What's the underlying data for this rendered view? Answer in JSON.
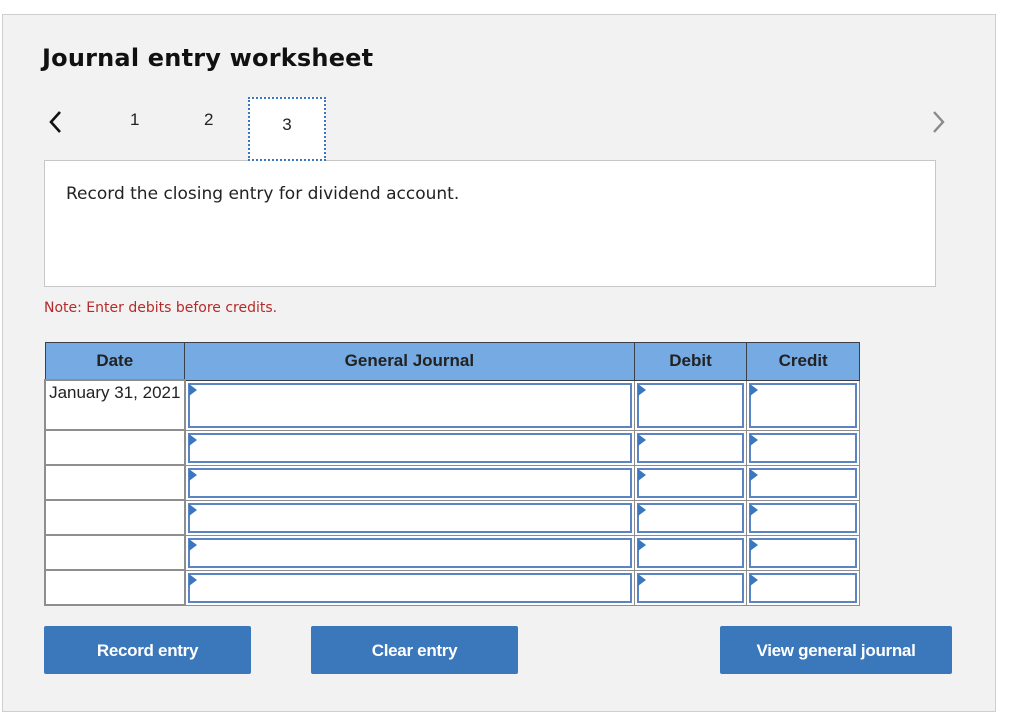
{
  "worksheet": {
    "title": "Journal entry worksheet",
    "nav": {
      "prev_icon": "chevron-left-icon",
      "next_icon": "chevron-right-icon",
      "tabs": [
        {
          "label": "1",
          "active": false
        },
        {
          "label": "2",
          "active": false
        },
        {
          "label": "3",
          "active": true
        }
      ]
    },
    "prompt": "Record the closing entry for dividend account.",
    "note": "Note: Enter debits before credits.",
    "table": {
      "headers": [
        "Date",
        "General Journal",
        "Debit",
        "Credit"
      ],
      "rows": [
        {
          "date": "January 31, 2021",
          "account": "",
          "debit": "",
          "credit": ""
        },
        {
          "date": "",
          "account": "",
          "debit": "",
          "credit": ""
        },
        {
          "date": "",
          "account": "",
          "debit": "",
          "credit": ""
        },
        {
          "date": "",
          "account": "",
          "debit": "",
          "credit": ""
        },
        {
          "date": "",
          "account": "",
          "debit": "",
          "credit": ""
        },
        {
          "date": "",
          "account": "",
          "debit": "",
          "credit": ""
        }
      ]
    },
    "buttons": {
      "record": "Record entry",
      "clear": "Clear entry",
      "view": "View general journal"
    },
    "colors": {
      "header_blue": "#75aae3",
      "button_blue": "#3b77bb",
      "note_red": "#b52a2a",
      "panel_bg": "#f2f2f2"
    }
  }
}
